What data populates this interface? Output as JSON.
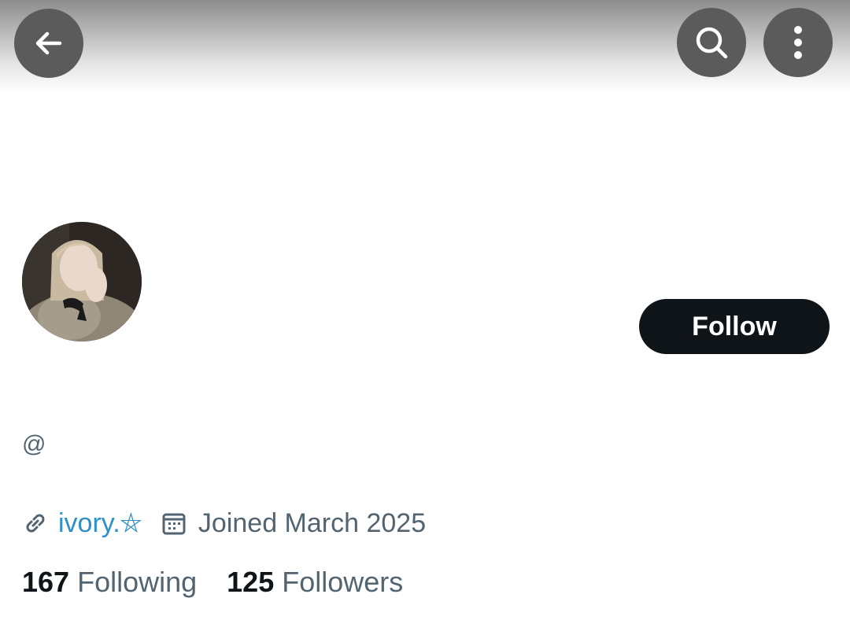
{
  "header": {
    "back_icon": "arrow-left-icon",
    "search_icon": "search-icon",
    "more_icon": "more-vertical-icon",
    "button_color": "#5b5b5b"
  },
  "profile": {
    "display_name": "",
    "handle": "@",
    "avatar": "profile-photo",
    "follow_label": "Follow",
    "website_icon": "link-icon",
    "website": "ivory.⛤",
    "joined_icon": "calendar-icon",
    "joined": "Joined March 2025",
    "following_count": "167",
    "following_label": "Following",
    "followers_count": "125",
    "followers_label": "Followers"
  },
  "colors": {
    "link": "#2f8fc8",
    "secondary_text": "#536471",
    "primary_text": "#0f1419",
    "follow_button": "#0f1419"
  }
}
